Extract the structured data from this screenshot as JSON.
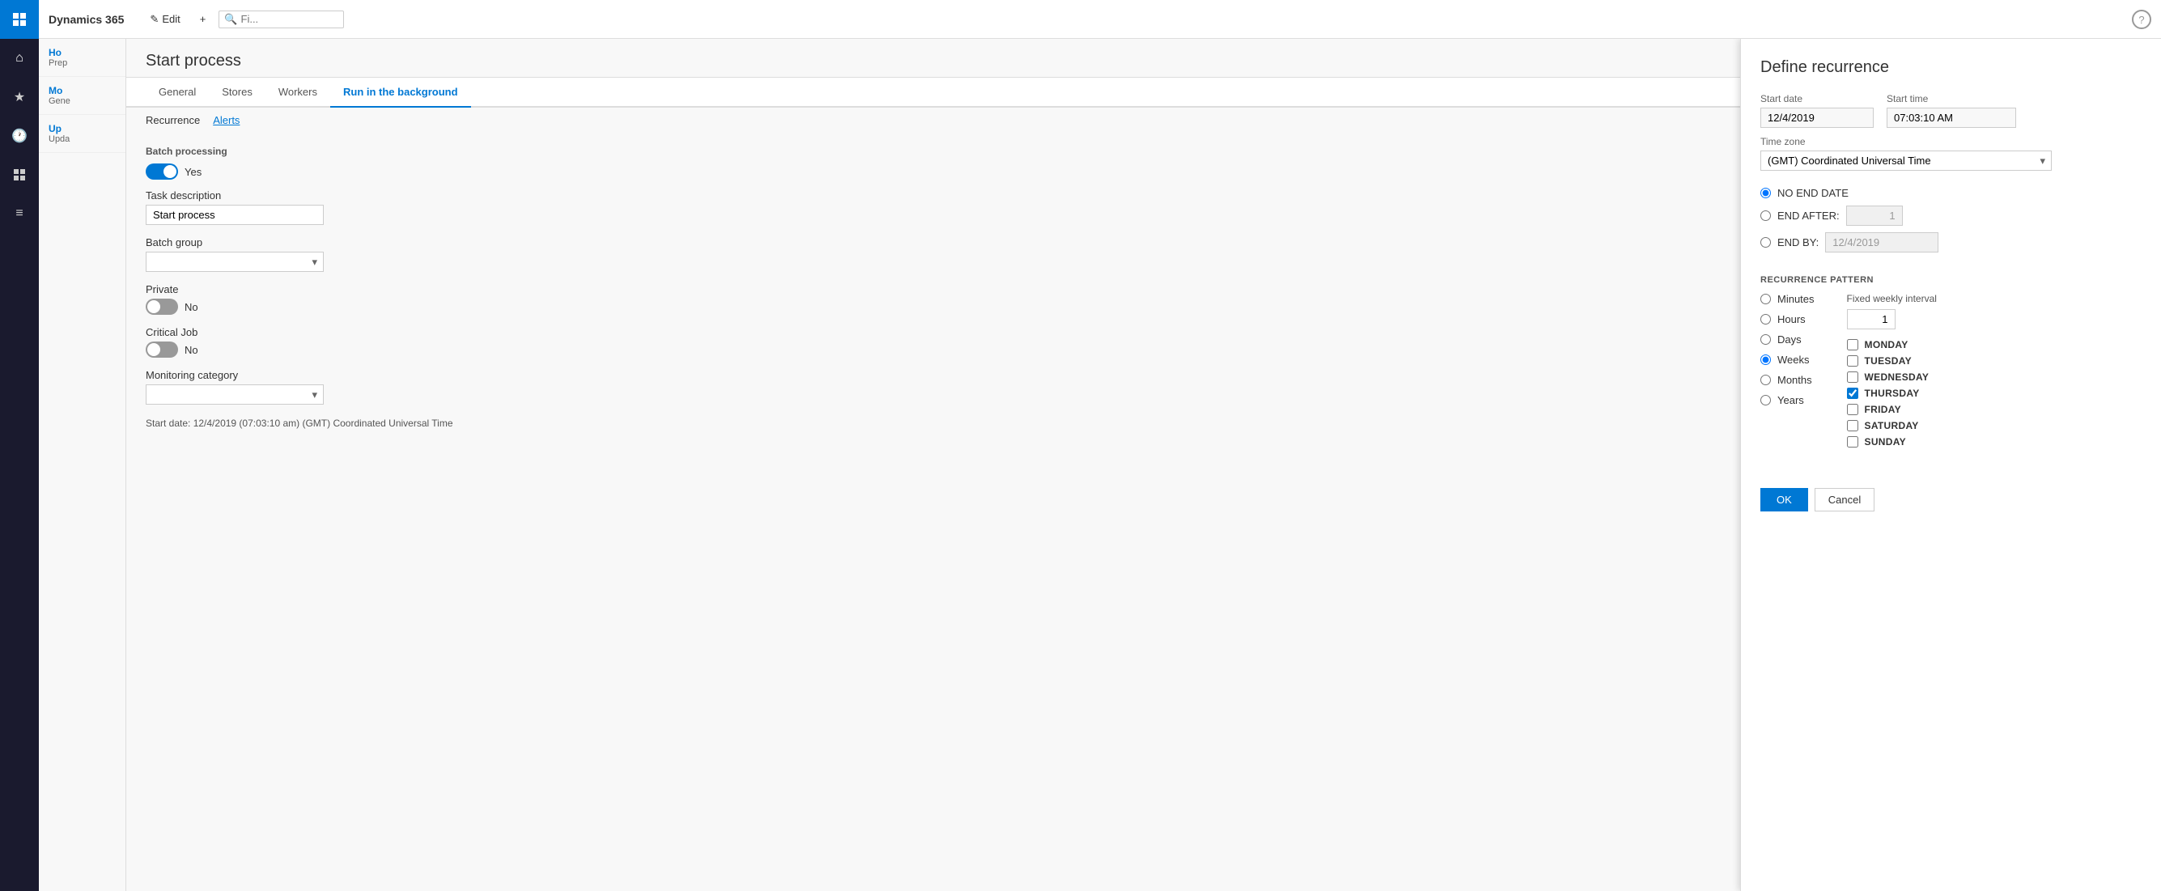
{
  "app": {
    "brand": "Dynamics 365"
  },
  "toolbar": {
    "edit_label": "Edit",
    "new_label": "+",
    "search_placeholder": "Fi..."
  },
  "nav_icons": [
    "⊞",
    "★",
    "🕐",
    "⊞",
    "≡"
  ],
  "records": [
    {
      "title": "Ho",
      "sub": "Prep"
    },
    {
      "title": "Mo",
      "sub": "Gene"
    },
    {
      "title": "Up",
      "sub": "Upda"
    }
  ],
  "start_process": {
    "title": "Start process",
    "tabs": [
      "General",
      "Stores",
      "Workers",
      "Run in the background"
    ],
    "active_tab": "Run in the background",
    "sub_tabs": [
      "Recurrence",
      "Alerts"
    ],
    "active_sub_tab": "Recurrence",
    "batch_processing": {
      "label": "Batch processing",
      "toggle_state": "on",
      "toggle_label": "Yes"
    },
    "task_description": {
      "label": "Task description",
      "value": "Start process"
    },
    "batch_group": {
      "label": "Batch group",
      "value": ""
    },
    "private": {
      "label": "Private",
      "toggle_state": "off",
      "toggle_label": "No"
    },
    "critical_job": {
      "label": "Critical Job",
      "toggle_state": "off",
      "toggle_label": "No"
    },
    "monitoring_category": {
      "label": "Monitoring category",
      "value": ""
    },
    "start_date_info": "Start date: 12/4/2019 (07:03:10 am) (GMT) Coordinated Universal Time"
  },
  "define_recurrence": {
    "title": "Define recurrence",
    "start_date_label": "Start date",
    "start_date_value": "12/4/2019",
    "start_time_label": "Start time",
    "start_time_value": "07:03:10 AM",
    "timezone_label": "Time zone",
    "timezone_value": "(GMT) Coordinated Universal Time",
    "end_options": {
      "no_end_date": "NO END DATE",
      "end_after": "END AFTER:",
      "end_after_value": "1",
      "end_by": "END BY:",
      "end_by_value": "12/4/2019",
      "selected": "no_end_date"
    },
    "recurrence_pattern": {
      "header": "RECURRENCE PATTERN",
      "options": [
        "Minutes",
        "Hours",
        "Days",
        "Weeks",
        "Months",
        "Years"
      ],
      "selected": "Weeks"
    },
    "fixed_weekly_interval": {
      "label": "Fixed weekly interval",
      "value": "1"
    },
    "days": {
      "monday": {
        "label": "MONDAY",
        "checked": false
      },
      "tuesday": {
        "label": "TUESDAY",
        "checked": false
      },
      "wednesday": {
        "label": "WEDNESDAY",
        "checked": false
      },
      "thursday": {
        "label": "THURSDAY",
        "checked": true
      },
      "friday": {
        "label": "FRIDAY",
        "checked": false
      },
      "saturday": {
        "label": "SATURDAY",
        "checked": false
      },
      "sunday": {
        "label": "SUNDAY",
        "checked": false
      }
    },
    "ok_label": "OK",
    "cancel_label": "Cancel"
  }
}
